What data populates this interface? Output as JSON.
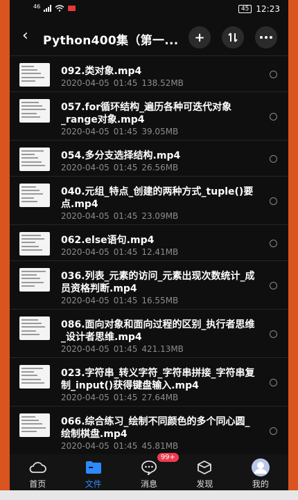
{
  "status": {
    "network": "46",
    "time": "12:23",
    "battery": "45"
  },
  "header": {
    "title": "Python400集（第一..."
  },
  "files": [
    {
      "name": "092.类对象.mp4",
      "date": "2020-04-05",
      "time": "01:45",
      "size": "138.52MB"
    },
    {
      "name": "057.for循环结构_遍历各种可迭代对象_range对象.mp4",
      "date": "2020-04-05",
      "time": "01:45",
      "size": "39.05MB"
    },
    {
      "name": "054.多分支选择结构.mp4",
      "date": "2020-04-05",
      "time": "01:45",
      "size": "26.56MB"
    },
    {
      "name": "040.元组_特点_创建的两种方式_tuple()要点.mp4",
      "date": "2020-04-05",
      "time": "01:45",
      "size": "23.09MB"
    },
    {
      "name": "062.else语句.mp4",
      "date": "2020-04-05",
      "time": "01:45",
      "size": "12.41MB"
    },
    {
      "name": "036.列表_元素的访问_元素出现次数统计_成员资格判断.mp4",
      "date": "2020-04-05",
      "time": "01:45",
      "size": "16.55MB"
    },
    {
      "name": "086.面向对象和面向过程的区别_执行者思维_设计者思维.mp4",
      "date": "2020-04-05",
      "time": "01:45",
      "size": "421.13MB"
    },
    {
      "name": "023.字符串_转义字符_字符串拼接_字符串复制_input()获得键盘输入.mp4",
      "date": "2020-04-05",
      "time": "01:45",
      "size": "27.64MB"
    },
    {
      "name": "066.综合练习_绘制不同颜色的多个同心圆_绘制棋盘.mp4",
      "date": "2020-04-05",
      "time": "01:45",
      "size": "45.81MB"
    }
  ],
  "nav": {
    "items": [
      {
        "label": "首页",
        "icon": "cloud-icon"
      },
      {
        "label": "文件",
        "icon": "folder-icon"
      },
      {
        "label": "消息",
        "icon": "chat-icon",
        "badge": "99+"
      },
      {
        "label": "发现",
        "icon": "cube-icon"
      },
      {
        "label": "我的",
        "icon": "avatar-icon"
      }
    ]
  },
  "colors": {
    "accent": "#2e89ff",
    "badge": "#ef3b4f",
    "frame": "#d9541f"
  }
}
